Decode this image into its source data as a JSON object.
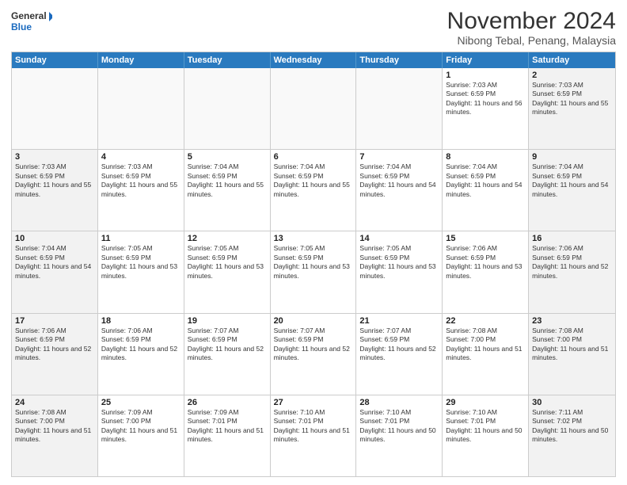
{
  "logo": {
    "general": "General",
    "blue": "Blue"
  },
  "title": "November 2024",
  "location": "Nibong Tebal, Penang, Malaysia",
  "weekdays": [
    "Sunday",
    "Monday",
    "Tuesday",
    "Wednesday",
    "Thursday",
    "Friday",
    "Saturday"
  ],
  "weeks": [
    [
      {
        "day": "",
        "info": ""
      },
      {
        "day": "",
        "info": ""
      },
      {
        "day": "",
        "info": ""
      },
      {
        "day": "",
        "info": ""
      },
      {
        "day": "",
        "info": ""
      },
      {
        "day": "1",
        "sunrise": "Sunrise: 7:03 AM",
        "sunset": "Sunset: 6:59 PM",
        "daylight": "Daylight: 11 hours and 56 minutes."
      },
      {
        "day": "2",
        "sunrise": "Sunrise: 7:03 AM",
        "sunset": "Sunset: 6:59 PM",
        "daylight": "Daylight: 11 hours and 55 minutes."
      }
    ],
    [
      {
        "day": "3",
        "sunrise": "Sunrise: 7:03 AM",
        "sunset": "Sunset: 6:59 PM",
        "daylight": "Daylight: 11 hours and 55 minutes."
      },
      {
        "day": "4",
        "sunrise": "Sunrise: 7:03 AM",
        "sunset": "Sunset: 6:59 PM",
        "daylight": "Daylight: 11 hours and 55 minutes."
      },
      {
        "day": "5",
        "sunrise": "Sunrise: 7:04 AM",
        "sunset": "Sunset: 6:59 PM",
        "daylight": "Daylight: 11 hours and 55 minutes."
      },
      {
        "day": "6",
        "sunrise": "Sunrise: 7:04 AM",
        "sunset": "Sunset: 6:59 PM",
        "daylight": "Daylight: 11 hours and 55 minutes."
      },
      {
        "day": "7",
        "sunrise": "Sunrise: 7:04 AM",
        "sunset": "Sunset: 6:59 PM",
        "daylight": "Daylight: 11 hours and 54 minutes."
      },
      {
        "day": "8",
        "sunrise": "Sunrise: 7:04 AM",
        "sunset": "Sunset: 6:59 PM",
        "daylight": "Daylight: 11 hours and 54 minutes."
      },
      {
        "day": "9",
        "sunrise": "Sunrise: 7:04 AM",
        "sunset": "Sunset: 6:59 PM",
        "daylight": "Daylight: 11 hours and 54 minutes."
      }
    ],
    [
      {
        "day": "10",
        "sunrise": "Sunrise: 7:04 AM",
        "sunset": "Sunset: 6:59 PM",
        "daylight": "Daylight: 11 hours and 54 minutes."
      },
      {
        "day": "11",
        "sunrise": "Sunrise: 7:05 AM",
        "sunset": "Sunset: 6:59 PM",
        "daylight": "Daylight: 11 hours and 53 minutes."
      },
      {
        "day": "12",
        "sunrise": "Sunrise: 7:05 AM",
        "sunset": "Sunset: 6:59 PM",
        "daylight": "Daylight: 11 hours and 53 minutes."
      },
      {
        "day": "13",
        "sunrise": "Sunrise: 7:05 AM",
        "sunset": "Sunset: 6:59 PM",
        "daylight": "Daylight: 11 hours and 53 minutes."
      },
      {
        "day": "14",
        "sunrise": "Sunrise: 7:05 AM",
        "sunset": "Sunset: 6:59 PM",
        "daylight": "Daylight: 11 hours and 53 minutes."
      },
      {
        "day": "15",
        "sunrise": "Sunrise: 7:06 AM",
        "sunset": "Sunset: 6:59 PM",
        "daylight": "Daylight: 11 hours and 53 minutes."
      },
      {
        "day": "16",
        "sunrise": "Sunrise: 7:06 AM",
        "sunset": "Sunset: 6:59 PM",
        "daylight": "Daylight: 11 hours and 52 minutes."
      }
    ],
    [
      {
        "day": "17",
        "sunrise": "Sunrise: 7:06 AM",
        "sunset": "Sunset: 6:59 PM",
        "daylight": "Daylight: 11 hours and 52 minutes."
      },
      {
        "day": "18",
        "sunrise": "Sunrise: 7:06 AM",
        "sunset": "Sunset: 6:59 PM",
        "daylight": "Daylight: 11 hours and 52 minutes."
      },
      {
        "day": "19",
        "sunrise": "Sunrise: 7:07 AM",
        "sunset": "Sunset: 6:59 PM",
        "daylight": "Daylight: 11 hours and 52 minutes."
      },
      {
        "day": "20",
        "sunrise": "Sunrise: 7:07 AM",
        "sunset": "Sunset: 6:59 PM",
        "daylight": "Daylight: 11 hours and 52 minutes."
      },
      {
        "day": "21",
        "sunrise": "Sunrise: 7:07 AM",
        "sunset": "Sunset: 6:59 PM",
        "daylight": "Daylight: 11 hours and 52 minutes."
      },
      {
        "day": "22",
        "sunrise": "Sunrise: 7:08 AM",
        "sunset": "Sunset: 7:00 PM",
        "daylight": "Daylight: 11 hours and 51 minutes."
      },
      {
        "day": "23",
        "sunrise": "Sunrise: 7:08 AM",
        "sunset": "Sunset: 7:00 PM",
        "daylight": "Daylight: 11 hours and 51 minutes."
      }
    ],
    [
      {
        "day": "24",
        "sunrise": "Sunrise: 7:08 AM",
        "sunset": "Sunset: 7:00 PM",
        "daylight": "Daylight: 11 hours and 51 minutes."
      },
      {
        "day": "25",
        "sunrise": "Sunrise: 7:09 AM",
        "sunset": "Sunset: 7:00 PM",
        "daylight": "Daylight: 11 hours and 51 minutes."
      },
      {
        "day": "26",
        "sunrise": "Sunrise: 7:09 AM",
        "sunset": "Sunset: 7:01 PM",
        "daylight": "Daylight: 11 hours and 51 minutes."
      },
      {
        "day": "27",
        "sunrise": "Sunrise: 7:10 AM",
        "sunset": "Sunset: 7:01 PM",
        "daylight": "Daylight: 11 hours and 51 minutes."
      },
      {
        "day": "28",
        "sunrise": "Sunrise: 7:10 AM",
        "sunset": "Sunset: 7:01 PM",
        "daylight": "Daylight: 11 hours and 50 minutes."
      },
      {
        "day": "29",
        "sunrise": "Sunrise: 7:10 AM",
        "sunset": "Sunset: 7:01 PM",
        "daylight": "Daylight: 11 hours and 50 minutes."
      },
      {
        "day": "30",
        "sunrise": "Sunrise: 7:11 AM",
        "sunset": "Sunset: 7:02 PM",
        "daylight": "Daylight: 11 hours and 50 minutes."
      }
    ]
  ]
}
